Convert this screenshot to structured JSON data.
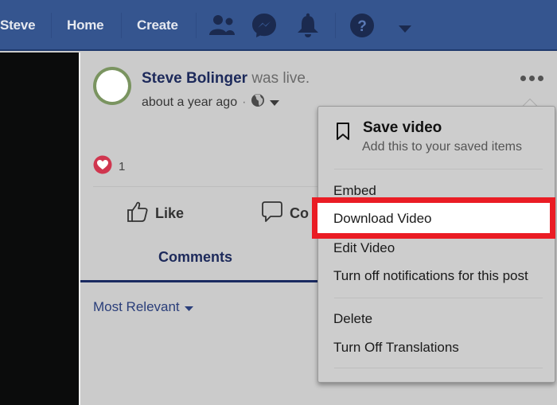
{
  "topbar": {
    "nav_links": [
      "Steve",
      "Home",
      "Create"
    ],
    "icons": [
      "friends-icon",
      "messenger-icon",
      "notifications-bell-icon",
      "help-question-icon",
      "account-dropdown-caret-icon"
    ],
    "background": "#35558f"
  },
  "post": {
    "author": "Steve Bolinger",
    "action": "was live.",
    "timestamp": "about a year ago",
    "separator": "·",
    "privacy_icon": "globe-icon",
    "reactions": {
      "icon": "love-reaction-icon",
      "count": "1"
    },
    "actions": {
      "like": "Like",
      "comment": "Co"
    },
    "tabs": {
      "comments": "Comments"
    },
    "sort_label": "Most Relevant"
  },
  "menu": {
    "save": {
      "title": "Save video",
      "subtitle": "Add this to your saved items"
    },
    "items": [
      "Embed",
      "Download Video",
      "Edit Video",
      "Turn off notifications for this post",
      "Delete",
      "Turn Off Translations"
    ],
    "highlighted_index": 1,
    "highlight_color": "#ea1c24"
  }
}
